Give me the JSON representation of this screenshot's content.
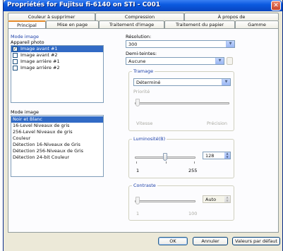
{
  "window": {
    "title": "Propriétés for Fujitsu fi-6140 on STI - C001"
  },
  "tabs_back": [
    {
      "label": "Couleur à supprimer"
    },
    {
      "label": "Compression"
    },
    {
      "label": "À propos de"
    }
  ],
  "tabs_front": [
    {
      "label": "Principal"
    },
    {
      "label": "Mise en page"
    },
    {
      "label": "Traitement d'image"
    },
    {
      "label": "Traitement du papier"
    },
    {
      "label": "Gamme"
    }
  ],
  "left": {
    "mode_image_header": "Mode image",
    "appareil_label": "Appareil photo",
    "cameras": [
      {
        "label": "Image avant #1",
        "checked": true,
        "selected": true
      },
      {
        "label": "Image avant #2",
        "checked": false,
        "selected": false
      },
      {
        "label": "Image arrière #1",
        "checked": false,
        "selected": false
      },
      {
        "label": "Image arrière #2",
        "checked": false,
        "selected": false
      }
    ],
    "mode_image_label": "Mode image",
    "modes": [
      {
        "label": "Noir et Blanc",
        "selected": true
      },
      {
        "label": "16-Level Niveaux de gris",
        "selected": false
      },
      {
        "label": "256-Level Niveaux de gris",
        "selected": false
      },
      {
        "label": "Couleur",
        "selected": false
      },
      {
        "label": "Détection 16-Niveaux de Gris",
        "selected": false
      },
      {
        "label": "Détection 256-Niveaux de Gris",
        "selected": false
      },
      {
        "label": "Détection 24-bit Couleur",
        "selected": false
      }
    ]
  },
  "right": {
    "resolution_label": "Résolution:",
    "resolution_value": "300",
    "demi_teintes_label": "Demi-teintes:",
    "demi_teintes_value": "Aucune",
    "tramage": {
      "legend": "Tramage",
      "value": "Déterminé",
      "priorite_label": "Priorité",
      "vitesse_label": "Vitesse",
      "precision_label": "Précision"
    },
    "luminosite": {
      "legend": "Luminosité(B)",
      "value": "128",
      "min_label": "1",
      "max_label": "255",
      "level": 128
    },
    "contraste": {
      "legend": "Contraste",
      "value": "Auto",
      "min_label": "1",
      "max_label": "100"
    }
  },
  "buttons": {
    "ok": "OK",
    "cancel": "Annuler",
    "defaults": "Valeurs par défaut"
  },
  "colors": {
    "titlebar": "#0a4fd0",
    "selection": "#316ac5",
    "group_legend": "#1b3fa8"
  }
}
